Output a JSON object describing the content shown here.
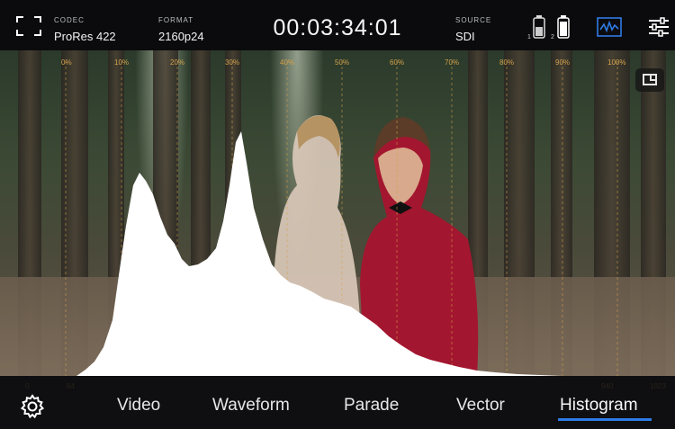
{
  "topbar": {
    "codec_label": "CODEC",
    "codec_value": "ProRes 422",
    "format_label": "FORMAT",
    "format_value": "2160p24",
    "timecode": "00:03:34:01",
    "source_label": "SOURCE",
    "source_value": "SDI",
    "battery_1_index": "1",
    "battery_2_index": "2"
  },
  "histogram": {
    "percent_labels": [
      "0%",
      "10%",
      "20%",
      "30%",
      "40%",
      "50%",
      "60%",
      "70%",
      "80%",
      "90%",
      "100%"
    ],
    "code_labels": {
      "low_0": "0",
      "low_64": "64",
      "high_940": "940",
      "high_1023": "1023"
    }
  },
  "tabs": [
    {
      "label": "Video"
    },
    {
      "label": "Waveform"
    },
    {
      "label": "Parade"
    },
    {
      "label": "Vector"
    },
    {
      "label": "Histogram"
    }
  ],
  "active_tab": "Histogram",
  "colors": {
    "accent": "#2f7be5",
    "scale": "#d4a24c"
  },
  "icons": {
    "focus": "fullscreen-frame-icon",
    "battery": "battery-icon",
    "scope": "waveform-scope-icon",
    "settings_top": "sliders-icon",
    "settings_bottom": "gear-icon",
    "pip": "picture-in-picture-icon"
  }
}
